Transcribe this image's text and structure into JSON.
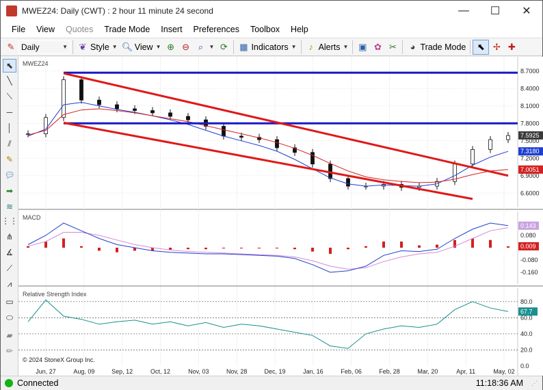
{
  "window": {
    "title": "MWEZ24: Daily (CWT) : 2 hour 11 minute 24 second",
    "minimize": "—",
    "maximize": "☐",
    "close": "✕"
  },
  "menu": [
    "File",
    "View",
    "Quotes",
    "Trade Mode",
    "Insert",
    "Preferences",
    "Toolbox",
    "Help"
  ],
  "toolbar": {
    "interval": "Daily",
    "style": "Style",
    "view": "View",
    "indicators": "Indicators",
    "alerts": "Alerts",
    "trade_mode": "Trade Mode"
  },
  "status": {
    "connection": "Connected",
    "time": "11:18:36 AM"
  },
  "chart_data": [
    {
      "type": "line",
      "name": "MWEZ24",
      "x": [
        "Jun, 27",
        "Aug, 09",
        "Sep, 12",
        "Oct, 12",
        "Nov, 03",
        "Nov, 28",
        "Dec, 19",
        "Jan, 16",
        "Feb, 06",
        "Feb, 28",
        "Mar, 20",
        "Apr, 11",
        "May, 02"
      ],
      "y_ticks": [
        "8.7000",
        "8.4000",
        "8.1000",
        "7.8000",
        "7.5000",
        "7.2000",
        "6.9000",
        "6.6000"
      ],
      "ylim": [
        6.45,
        8.85
      ],
      "close": [
        7.62,
        7.9,
        8.55,
        8.2,
        8.12,
        8.05,
        8.02,
        7.98,
        7.92,
        7.86,
        7.75,
        7.58,
        7.56,
        7.52,
        7.38,
        7.3,
        7.1,
        6.85,
        6.72,
        6.72,
        6.75,
        6.7,
        6.72,
        6.8,
        7.1,
        7.35,
        7.52,
        7.59
      ],
      "series": [
        {
          "name": "Fast MA",
          "color": "#1f3fd1",
          "values": [
            7.58,
            7.7,
            8.12,
            8.16,
            8.1,
            8.04,
            7.99,
            7.93,
            7.86,
            7.78,
            7.68,
            7.58,
            7.5,
            7.42,
            7.32,
            7.18,
            7.02,
            6.86,
            6.76,
            6.72,
            6.74,
            6.73,
            6.72,
            6.76,
            6.9,
            7.08,
            7.22,
            7.318
          ]
        },
        {
          "name": "Slow MA",
          "color": "#d42020",
          "values": [
            7.6,
            7.68,
            7.95,
            8.03,
            8.05,
            8.02,
            7.98,
            7.93,
            7.88,
            7.83,
            7.76,
            7.69,
            7.62,
            7.55,
            7.47,
            7.37,
            7.25,
            7.11,
            6.98,
            6.88,
            6.83,
            6.8,
            6.78,
            6.79,
            6.84,
            6.92,
            6.98,
            7.0051
          ]
        }
      ],
      "levels": [
        {
          "value": 8.67,
          "color": "#1818c8"
        },
        {
          "value": 7.8,
          "color": "#1818c8"
        }
      ],
      "trendlines": [
        {
          "color": "#e01818",
          "from": {
            "index": 2,
            "value": 8.66
          },
          "to": {
            "index": 27,
            "value": 6.9
          }
        },
        {
          "color": "#e01818",
          "from": {
            "index": 2,
            "value": 7.81
          },
          "to": {
            "index": 25,
            "value": 6.5
          }
        }
      ],
      "price_labels": [
        {
          "text": "7.5925",
          "value": 7.5925,
          "bg": "#3a3a3a",
          "fg": "#ffffff"
        },
        {
          "text": "7.3180",
          "value": 7.318,
          "bg": "#1f3fd1",
          "fg": "#ffffff"
        },
        {
          "text": "7.0051",
          "value": 7.0051,
          "bg": "#d42020",
          "fg": "#ffffff"
        }
      ]
    },
    {
      "type": "bar",
      "name": "MACD",
      "y_ticks": [
        "0.080",
        "-0.080",
        "-0.160"
      ],
      "ylim": [
        -0.2,
        0.2
      ],
      "macd": [
        0.02,
        0.08,
        0.16,
        0.11,
        0.06,
        0.02,
        0.0,
        -0.02,
        -0.03,
        -0.035,
        -0.04,
        -0.04,
        -0.045,
        -0.05,
        -0.055,
        -0.07,
        -0.11,
        -0.16,
        -0.15,
        -0.12,
        -0.05,
        -0.02,
        -0.025,
        -0.01,
        0.06,
        0.12,
        0.16,
        0.143
      ],
      "signal": [
        0.01,
        0.04,
        0.1,
        0.1,
        0.08,
        0.05,
        0.02,
        0.0,
        -0.015,
        -0.025,
        -0.03,
        -0.035,
        -0.04,
        -0.045,
        -0.05,
        -0.06,
        -0.085,
        -0.12,
        -0.14,
        -0.13,
        -0.09,
        -0.06,
        -0.04,
        -0.03,
        0.01,
        0.06,
        0.11,
        0.13
      ],
      "histogram": [
        0.01,
        0.04,
        0.06,
        0.01,
        -0.02,
        -0.03,
        -0.02,
        -0.02,
        -0.015,
        -0.01,
        -0.01,
        -0.005,
        -0.005,
        -0.005,
        -0.005,
        -0.01,
        -0.025,
        -0.04,
        -0.01,
        0.01,
        0.04,
        0.04,
        0.015,
        0.02,
        0.05,
        0.06,
        0.05,
        0.009
      ],
      "price_labels": [
        {
          "text": "0.143",
          "value": 0.143,
          "bg": "#c8a3e0",
          "fg": "#ffffff"
        },
        {
          "text": "0.009",
          "value": 0.009,
          "bg": "#d42020",
          "fg": "#ffffff"
        }
      ]
    },
    {
      "type": "line",
      "name": "Relative Strength Index",
      "y_ticks": [
        "80.0",
        "60.0",
        "40.0",
        "20.0",
        "0.0"
      ],
      "ylim": [
        -5,
        90
      ],
      "values": [
        55,
        82,
        62,
        58,
        52,
        55,
        57,
        52,
        55,
        50,
        54,
        48,
        52,
        50,
        46,
        42,
        38,
        25,
        22,
        40,
        46,
        50,
        48,
        52,
        70,
        80,
        72,
        67.7
      ],
      "levels": [
        80,
        60,
        40,
        20
      ],
      "price_labels": [
        {
          "text": "67.7",
          "value": 67.7,
          "bg": "#1a8f8f",
          "fg": "#ffffff"
        }
      ],
      "copyright": "© 2024 StoneX Group Inc."
    }
  ]
}
